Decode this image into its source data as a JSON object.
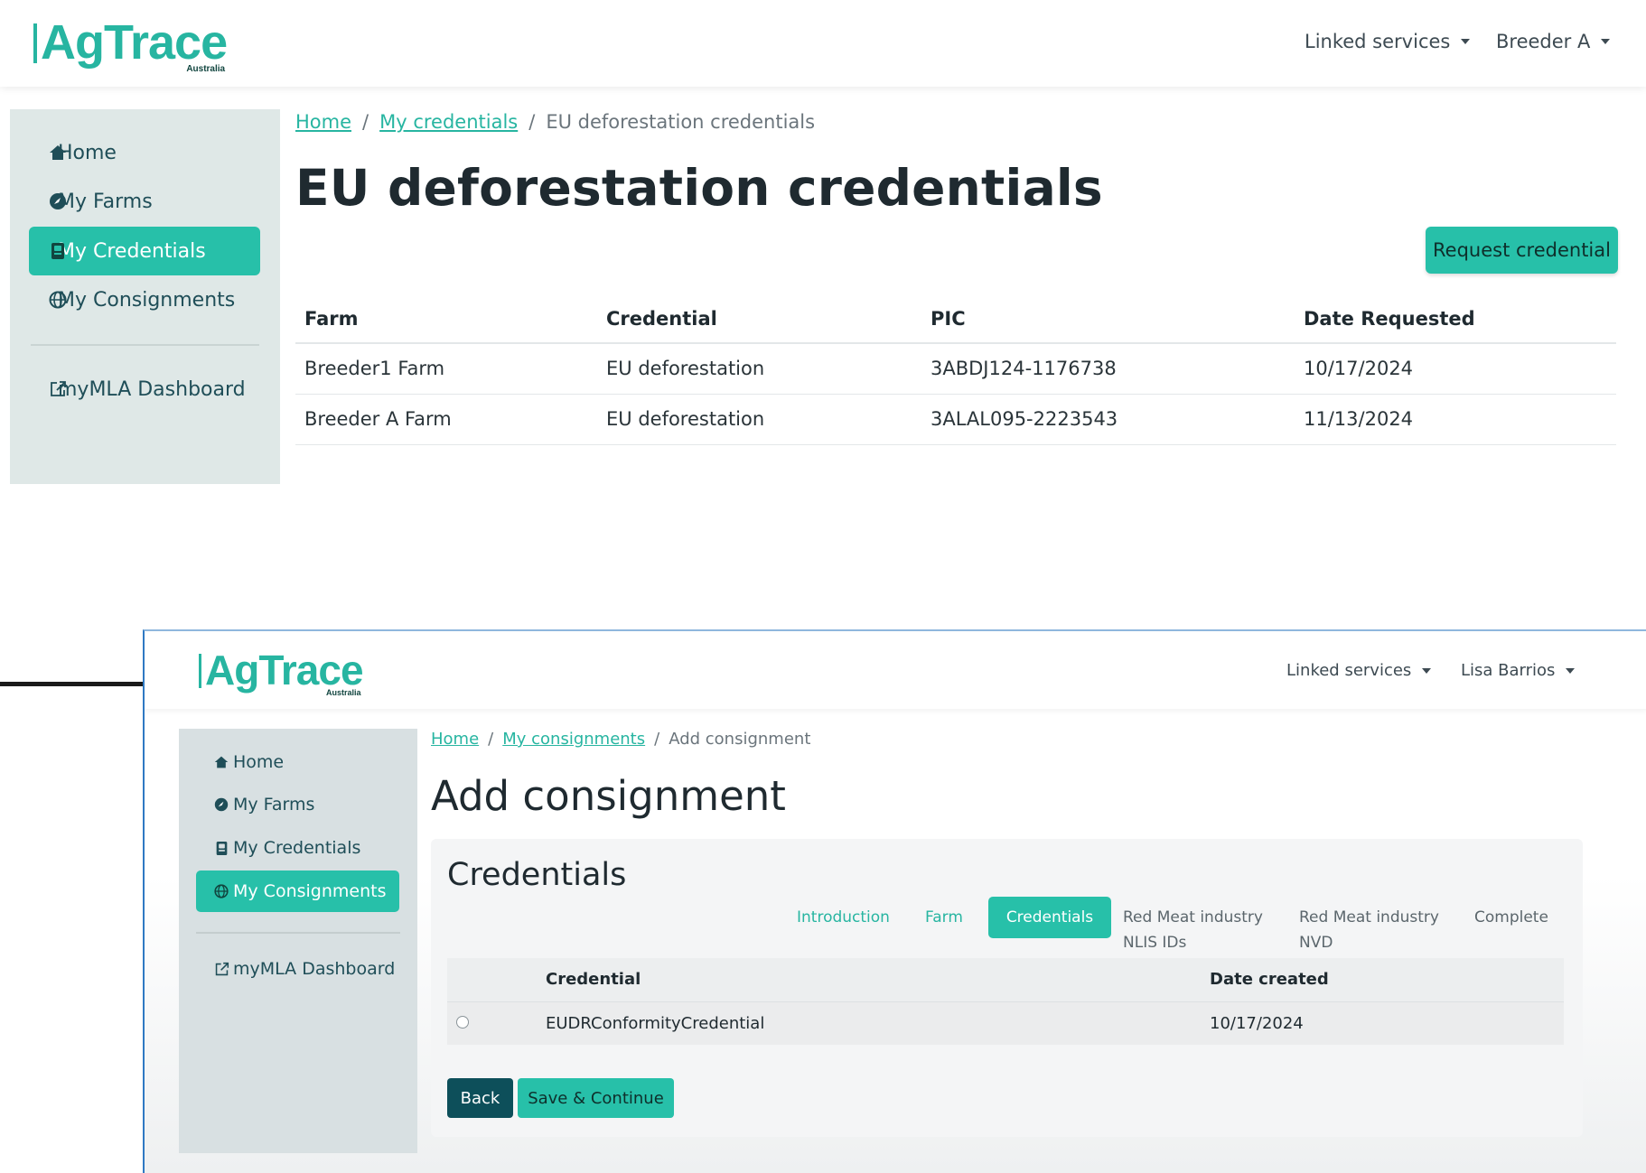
{
  "window1": {
    "logo": {
      "text": "AgTrace",
      "sub": "Australia"
    },
    "header": {
      "linked_services": "Linked services",
      "user": "Breeder A"
    },
    "sidebar": {
      "items": [
        {
          "label": "Home",
          "icon": "home-icon"
        },
        {
          "label": "My Farms",
          "icon": "compass-icon"
        },
        {
          "label": "My Credentials",
          "icon": "credential-badge-icon",
          "active": true
        },
        {
          "label": "My Consignments",
          "icon": "globe-icon"
        },
        {
          "label": "myMLA Dashboard",
          "icon": "external-link-icon"
        }
      ]
    },
    "breadcrumb": {
      "home": "Home",
      "sep1": "/",
      "credentials": "My credentials",
      "sep2": "/",
      "current": "EU deforestation credentials"
    },
    "title": "EU deforestation credentials",
    "request_button": "Request credential",
    "table": {
      "headers": [
        "Farm",
        "Credential",
        "PIC",
        "Date Requested"
      ],
      "rows": [
        [
          "Breeder1 Farm",
          "EU deforestation",
          "3ABDJ124-1176738",
          "10/17/2024"
        ],
        [
          "Breeder A Farm",
          "EU deforestation",
          "3ALAL095-2223543",
          "11/13/2024"
        ]
      ]
    }
  },
  "window2": {
    "logo": {
      "text": "AgTrace",
      "sub": "Australia"
    },
    "header": {
      "linked_services": "Linked services",
      "user": "Lisa Barrios"
    },
    "sidebar": {
      "items": [
        {
          "label": "Home",
          "icon": "home-icon"
        },
        {
          "label": "My Farms",
          "icon": "compass-icon"
        },
        {
          "label": "My Credentials",
          "icon": "credential-badge-icon"
        },
        {
          "label": "My Consignments",
          "icon": "globe-icon",
          "active": true
        },
        {
          "label": "myMLA Dashboard",
          "icon": "external-link-icon"
        }
      ]
    },
    "breadcrumb": {
      "home": "Home",
      "sep1": "/",
      "consignments": "My consignments",
      "sep2": "/",
      "current": "Add consignment"
    },
    "title": "Add consignment",
    "card_title": "Credentials",
    "steps": [
      {
        "label": "Introduction",
        "state": "done"
      },
      {
        "label": "Farm",
        "state": "done"
      },
      {
        "label": "Credentials",
        "state": "active"
      },
      {
        "label_line1": "Red Meat industry",
        "label_line2": "NLIS IDs",
        "state": "todo"
      },
      {
        "label_line1": "Red Meat industry",
        "label_line2": "NVD",
        "state": "todo"
      },
      {
        "label": "Complete",
        "state": "todo"
      }
    ],
    "table": {
      "headers": [
        "",
        "Credential",
        "Date created"
      ],
      "rows": [
        [
          "",
          "EUDRConformityCredential",
          "10/17/2024"
        ]
      ]
    },
    "back_button": "Back",
    "save_button": "Save & Continue"
  },
  "colors": {
    "accent": "#27c0a9",
    "dark_teal": "#0d4f5a",
    "link": "#27b5a1"
  }
}
